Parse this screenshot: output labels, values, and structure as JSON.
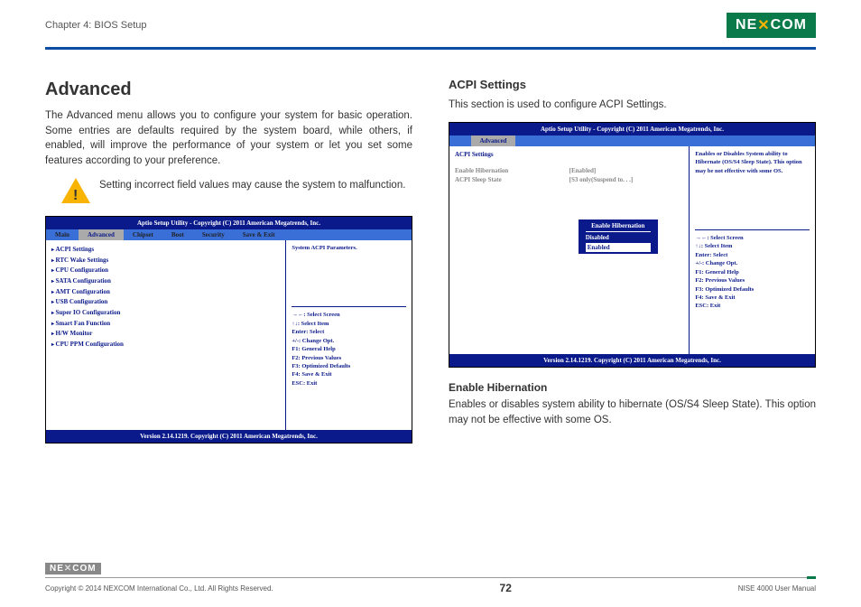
{
  "header": {
    "chapter": "Chapter 4: BIOS Setup",
    "logo": "NEXCOM"
  },
  "left": {
    "title": "Advanced",
    "intro": "The Advanced menu allows you to configure your system for basic operation. Some entries are defaults required by the system board, while others, if enabled, will improve the performance of your system or let you set some features according to your preference.",
    "warning": "Setting incorrect field values may cause the system to malfunction.",
    "bios": {
      "title": "Aptio Setup Utility - Copyright (C) 2011 American Megatrends, Inc.",
      "tabs": [
        "Main",
        "Advanced",
        "Chipset",
        "Boot",
        "Security",
        "Save & Exit"
      ],
      "active_tab": "Advanced",
      "items": [
        "ACPI Settings",
        "RTC Wake Settings",
        "CPU Configuration",
        "SATA Configuration",
        "AMT Configuration",
        "USB Configuration",
        "Super IO Configuration",
        "Smart Fan Function",
        "H/W Monitor",
        "CPU PPM Configuration"
      ],
      "help": "System ACPI Parameters.",
      "keys": [
        "→←: Select Screen",
        "↑↓: Select Item",
        "Enter: Select",
        "+/-: Change Opt.",
        "F1: General Help",
        "F2: Previous Values",
        "F3: Optimized Defaults",
        "F4: Save & Exit",
        "ESC: Exit"
      ],
      "footer": "Version 2.14.1219. Copyright (C) 2011 American Megatrends, Inc."
    }
  },
  "right": {
    "title": "ACPI Settings",
    "intro": "This section is used to configure ACPI Settings.",
    "bios": {
      "title": "Aptio Setup Utility - Copyright (C) 2011 American Megatrends, Inc.",
      "active_tab": "Advanced",
      "section": "ACPI Settings",
      "rows": [
        {
          "k": "Enable Hibernation",
          "v": "[Enabled]"
        },
        {
          "k": "ACPI Sleep State",
          "v": "[S3 only(Suspend to. . .]"
        }
      ],
      "popup": {
        "title": "Enable Hibernation",
        "opts": [
          "Disabled",
          "Enabled"
        ],
        "selected": "Enabled"
      },
      "help": "Enables or Disables System ability to Hibernate (OS/S4 Sleep State). This option may be not effective with some OS.",
      "keys": [
        "→←: Select Screen",
        "↑↓: Select Item",
        "Enter: Select",
        "+/-: Change Opt.",
        "F1: General Help",
        "F2: Previous Values",
        "F3: Optimized Defaults",
        "F4: Save & Exit",
        "ESC: Exit"
      ],
      "footer": "Version 2.14.1219. Copyright (C) 2011 American Megatrends, Inc."
    },
    "sub": {
      "title": "Enable Hibernation",
      "text": "Enables or disables system ability to hibernate (OS/S4 Sleep State). This option may not be effective with some OS."
    }
  },
  "footer": {
    "logo": "NEXCOM",
    "copyright": "Copyright © 2014 NEXCOM International Co., Ltd. All Rights Reserved.",
    "page": "72",
    "manual": "NISE 4000 User Manual"
  }
}
